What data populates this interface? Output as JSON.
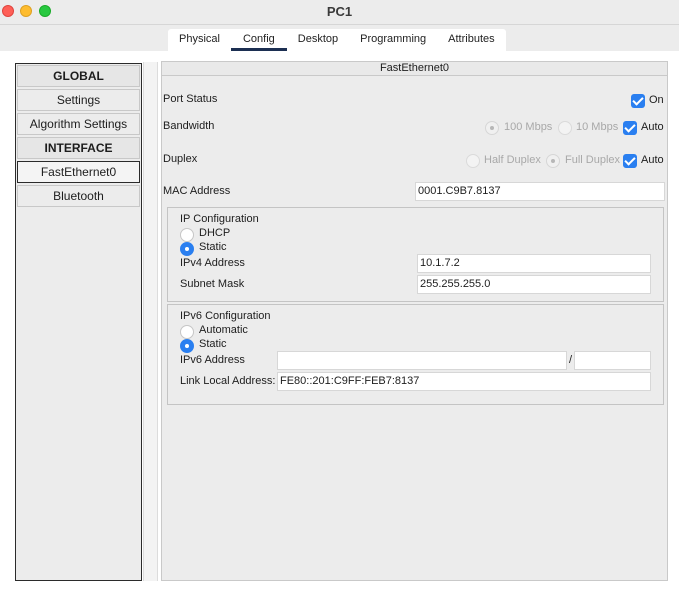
{
  "window": {
    "title": "PC1"
  },
  "tabs": [
    {
      "label": "Physical"
    },
    {
      "label": "Config"
    },
    {
      "label": "Desktop"
    },
    {
      "label": "Programming"
    },
    {
      "label": "Attributes"
    }
  ],
  "sidebar": {
    "items": [
      {
        "label": "GLOBAL"
      },
      {
        "label": "Settings"
      },
      {
        "label": "Algorithm Settings"
      },
      {
        "label": "INTERFACE"
      },
      {
        "label": "FastEthernet0"
      },
      {
        "label": "Bluetooth"
      }
    ],
    "selected": "FastEthernet0"
  },
  "interface": {
    "title": "FastEthernet0",
    "port_status": {
      "label": "Port Status",
      "checkbox_label": "On",
      "checked": true
    },
    "bandwidth": {
      "label": "Bandwidth",
      "options": [
        "100 Mbps",
        "10 Mbps"
      ],
      "selected": "100 Mbps",
      "auto_label": "Auto",
      "auto_checked": true
    },
    "duplex": {
      "label": "Duplex",
      "options": [
        "Half Duplex",
        "Full Duplex"
      ],
      "selected": "Full Duplex",
      "auto_label": "Auto",
      "auto_checked": true
    },
    "mac": {
      "label": "MAC Address",
      "value": "0001.C9B7.8137"
    },
    "ip_config": {
      "title": "IP Configuration",
      "options": [
        "DHCP",
        "Static"
      ],
      "selected": "Static",
      "ipv4_label": "IPv4 Address",
      "ipv4_value": "10.1.7.2",
      "mask_label": "Subnet Mask",
      "mask_value": "255.255.255.0"
    },
    "ipv6_config": {
      "title": "IPv6 Configuration",
      "options": [
        "Automatic",
        "Static"
      ],
      "selected": "Static",
      "ipv6_label": "IPv6 Address",
      "ipv6_value": "",
      "prefix_separator": "/",
      "prefix_value": "",
      "link_local_label": "Link Local Address:",
      "link_local_value": "FE80::201:C9FF:FEB7:8137"
    }
  },
  "colors": {
    "accent": "#2a7ff0",
    "tab_underline": "#1c2f52"
  }
}
